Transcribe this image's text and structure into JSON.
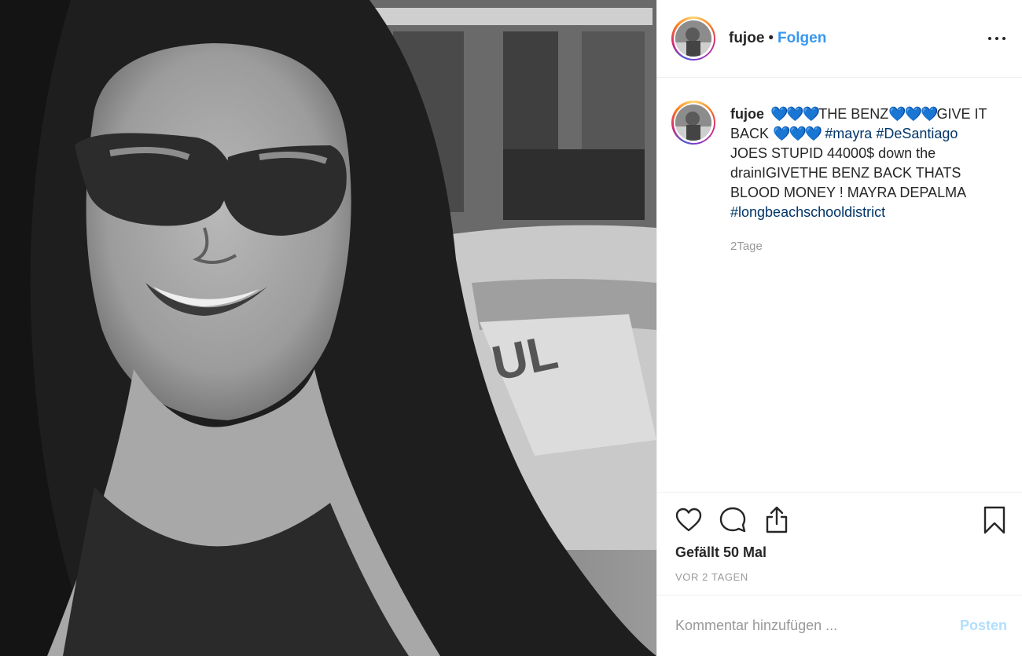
{
  "post": {
    "username": "fujoe",
    "separator": "•",
    "follow_label": "Folgen",
    "more_icon": "more-options-icon"
  },
  "caption": {
    "username": "fujoe",
    "hearts_1": "💙💙💙",
    "text_1": "THE BENZ",
    "hearts_2": "💙💙💙",
    "text_2": "GIVE IT BACK ",
    "hearts_3": "💙💙💙",
    "hashtag_1": "#mayra",
    "hashtag_2": "#DeSantiago",
    "text_3": "JOES STUPID 44000$ down the drainIGIVETHE BENZ BACK THATS BLOOD MONEY ! MAYRA DEPALMA",
    "hashtag_3": "#longbeachschooldistrict",
    "time": "2Tage"
  },
  "actions": {
    "like_icon": "heart-icon",
    "comment_icon": "comment-icon",
    "share_icon": "share-icon",
    "save_icon": "bookmark-icon",
    "likes_text": "Gefällt 50 Mal",
    "posted_ago": "VOR 2 TAGEN"
  },
  "comment": {
    "placeholder": "Kommentar hinzufügen ...",
    "post_label": "Posten"
  },
  "colors": {
    "accent": "#3897f0",
    "hashtag": "#003569",
    "muted": "#999999",
    "post_disabled": "#b2dffc",
    "border": "#efefef"
  }
}
